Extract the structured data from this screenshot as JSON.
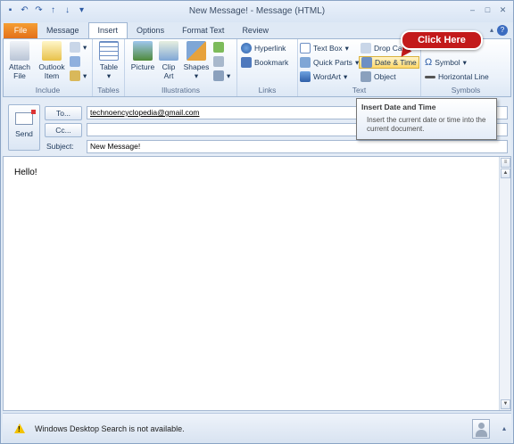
{
  "window": {
    "title": "New Message! - Message (HTML)",
    "qat_icons": [
      "save-icon",
      "undo-icon",
      "redo-icon",
      "up-arrow-icon",
      "down-arrow-icon",
      "customize-icon"
    ],
    "controls": {
      "minimize": "–",
      "maximize": "□",
      "close": "✕"
    }
  },
  "tabs": [
    {
      "label": "File",
      "active": false
    },
    {
      "label": "Message",
      "active": false
    },
    {
      "label": "Insert",
      "active": true
    },
    {
      "label": "Options",
      "active": false
    },
    {
      "label": "Format Text",
      "active": false
    },
    {
      "label": "Review",
      "active": false
    }
  ],
  "ribbon": {
    "include": {
      "label": "Include",
      "attach_file": "Attach File",
      "outlook_item": "Outlook Item"
    },
    "tables": {
      "label": "Tables",
      "table": "Table"
    },
    "illustrations": {
      "label": "Illustrations",
      "picture": "Picture",
      "clip_art": "Clip Art",
      "shapes": "Shapes"
    },
    "links": {
      "label": "Links",
      "hyperlink": "Hyperlink",
      "bookmark": "Bookmark"
    },
    "text": {
      "label": "Text",
      "text_box": "Text Box",
      "quick_parts": "Quick Parts",
      "wordart": "WordArt",
      "drop_cap": "Drop Ca",
      "date_time": "Date & Time",
      "object": "Object"
    },
    "symbols": {
      "label": "Symbols",
      "symbol": "Symbol",
      "horizontal_line": "Horizontal Line"
    }
  },
  "callout": {
    "text": "Click Here"
  },
  "tooltip": {
    "title": "Insert Date and Time",
    "body": "Insert the current date or time into the current document."
  },
  "header": {
    "send": "Send",
    "to_button": "To...",
    "to_value": "technoencyclopedia@gmail.com",
    "cc_button": "Cc...",
    "cc_value": "",
    "subject_label": "Subject:",
    "subject_value": "New Message!"
  },
  "body": {
    "text": "Hello!"
  },
  "status": {
    "text": "Windows Desktop Search is not available."
  },
  "colors": {
    "accent": "#e3701a",
    "callout": "#c31a1a",
    "ribbon_bg": "#eaf1fa"
  }
}
